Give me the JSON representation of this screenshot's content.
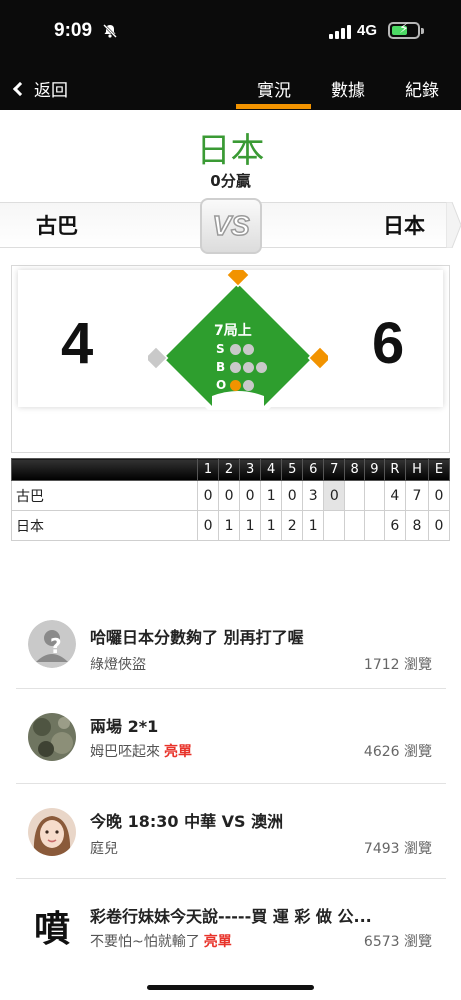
{
  "status_bar": {
    "time": "9:09",
    "network": "4G"
  },
  "nav": {
    "back_label": "返回",
    "tabs": [
      "實況",
      "數據",
      "紀錄"
    ],
    "active_tab": "實況"
  },
  "result": {
    "winner": "日本",
    "margin": "0分贏"
  },
  "matchup": {
    "away": "古巴",
    "home": "日本",
    "vs_label": "VS"
  },
  "scoreboard": {
    "away_score": "4",
    "home_score": "6",
    "inning": "7局上",
    "count_labels": [
      "S",
      "B",
      "O"
    ],
    "strikes": 0,
    "balls": 0,
    "outs": 1,
    "bases": {
      "first": true,
      "second": true,
      "third": false
    }
  },
  "linescore": {
    "headers": [
      "1",
      "2",
      "3",
      "4",
      "5",
      "6",
      "7",
      "8",
      "9",
      "R",
      "H",
      "E"
    ],
    "rows": [
      {
        "team": "古巴",
        "cells": [
          "0",
          "0",
          "0",
          "1",
          "0",
          "3",
          "0",
          "",
          "",
          "4",
          "7",
          "0"
        ]
      },
      {
        "team": "日本",
        "cells": [
          "0",
          "1",
          "1",
          "1",
          "2",
          "1",
          "",
          "",
          "",
          "6",
          "8",
          "0"
        ]
      }
    ],
    "current_inning_index": 6
  },
  "posts": [
    {
      "title": "哈囉日本分數夠了 別再打了喔",
      "author": "綠燈俠盜",
      "tag": "",
      "views": "1712 瀏覽",
      "avatar": "default-avatar-icon"
    },
    {
      "title": "兩場 2*1",
      "author": "姆巴呸起來",
      "tag": "亮單",
      "views": "4626 瀏覽",
      "avatar": "camo-avatar"
    },
    {
      "title": "今晚 18:30 中華 VS 澳洲",
      "author": "庭兒",
      "tag": "",
      "views": "7493 瀏覽",
      "avatar": "girl-avatar"
    },
    {
      "title": "彩卷行妹妹今天說-----買 運 彩 做 公...",
      "author": "不要怕~怕就輸了",
      "tag": "亮單",
      "views": "6573 瀏覽",
      "avatar": "calligraphy-avatar",
      "avatar_char": "噴"
    }
  ],
  "colors": {
    "accent": "#f29300",
    "win_green": "#3a9a34",
    "tag_red": "#e8332a",
    "field_green": "#2e9e2e"
  }
}
